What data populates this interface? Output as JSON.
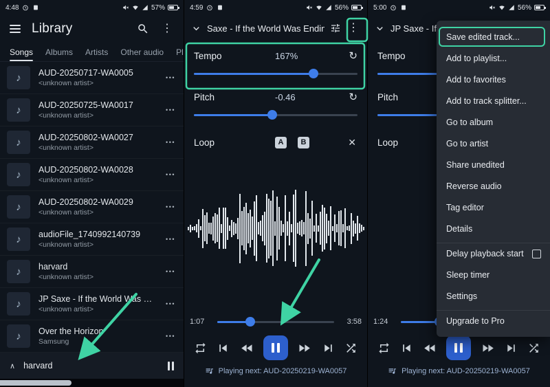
{
  "colors": {
    "teal": "#3fd3a4",
    "blue": "#3e7de9",
    "play": "#2d5fcc"
  },
  "icons": {
    "more": "•••",
    "kebab": "⋮",
    "reset": "↻",
    "close": "✕",
    "note": "♪",
    "chevron_up": "∧"
  },
  "library": {
    "status": {
      "time": "4:48",
      "battery": "57%"
    },
    "title": "Library",
    "tabs": [
      {
        "label": "Songs",
        "active": true
      },
      {
        "label": "Albums"
      },
      {
        "label": "Artists"
      },
      {
        "label": "Other audio"
      },
      {
        "label": "Play"
      }
    ],
    "songs": [
      {
        "title": "AUD-20250717-WA0005",
        "artist": "<unknown artist>"
      },
      {
        "title": "AUD-20250725-WA0017",
        "artist": "<unknown artist>"
      },
      {
        "title": "AUD-20250802-WA0027",
        "artist": "<unknown artist>"
      },
      {
        "title": "AUD-20250802-WA0028",
        "artist": "<unknown artist>"
      },
      {
        "title": "AUD-20250802-WA0029",
        "artist": "<unknown artist>"
      },
      {
        "title": "audioFile_1740992140739",
        "artist": "<unknown artist>"
      },
      {
        "title": "harvard",
        "artist": "<unknown artist>"
      },
      {
        "title": "JP Saxe - If the World Was End...",
        "artist": "<unknown artist>"
      },
      {
        "title": "Over the Horizon",
        "artist": "Samsung",
        "albumart": true
      }
    ],
    "mini_player": {
      "title": "harvard"
    }
  },
  "player": {
    "status": {
      "time": "4:59",
      "battery": "56%"
    },
    "title": "Saxe - If the World Was Ending (",
    "tempo": {
      "label": "Tempo",
      "value": "167%",
      "fraction": 0.73
    },
    "pitch": {
      "label": "Pitch",
      "value": "-0.46",
      "fraction": 0.48
    },
    "loop": {
      "label": "Loop",
      "a": "A",
      "b": "B"
    },
    "seek": {
      "elapsed": "1:07",
      "total": "3:58",
      "fraction": 0.28
    },
    "playing_next": "Playing next: AUD-20250219-WA0057"
  },
  "player_menu": {
    "status": {
      "time": "5:00",
      "battery": "56%"
    },
    "title": "JP Saxe - If t",
    "tempo": {
      "label": "Tempo",
      "fraction": 0.73
    },
    "pitch": {
      "label": "Pitch",
      "fraction": 0.48
    },
    "loop": {
      "label": "Loop"
    },
    "seek": {
      "elapsed": "1:24",
      "total": "",
      "fraction": 0.33
    },
    "playing_next": "Playing next: AUD-20250219-WA0057",
    "menu": {
      "items": [
        {
          "label": "Save edited track...",
          "highlight": true
        },
        {
          "label": "Add to playlist..."
        },
        {
          "label": "Add to favorites"
        },
        {
          "label": "Add to track splitter..."
        },
        {
          "label": "Go to album"
        },
        {
          "label": "Go to artist"
        },
        {
          "label": "Share unedited"
        },
        {
          "label": "Reverse audio"
        },
        {
          "label": "Tag editor"
        },
        {
          "label": "Details"
        },
        {
          "label": "Delay playback start",
          "checkbox": true,
          "divider": true
        },
        {
          "label": "Sleep timer"
        },
        {
          "label": "Settings"
        },
        {
          "label": "Upgrade to Pro",
          "divider": true
        }
      ]
    }
  }
}
